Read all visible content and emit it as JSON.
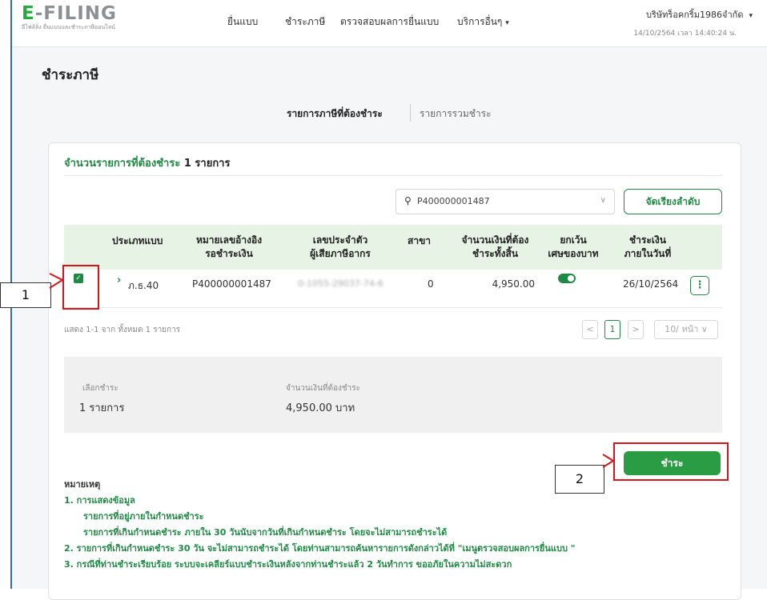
{
  "header": {
    "logo_main": "-FILING",
    "logo_e": "E",
    "logo_sub": "อีไฟล์ลิ่ง ยื่นแบบและชำระภาษีออนไลน์",
    "nav": [
      "ยื่นแบบ",
      "ชำระภาษี",
      "ตรวจสอบผลการยื่นแบบ",
      "บริการอื่นๆ"
    ],
    "nav_more_caret": "▾",
    "user_name": "บริษัทร็อคกริ้ม1986จำกัด",
    "user_caret": "▾",
    "date_text": "14/10/2564 เวลา 14:40:24 น."
  },
  "page": {
    "title": "ชำระภาษี",
    "tabs": [
      "รายการภาษีที่ต้องชำระ",
      "รายการรวมชำระ"
    ]
  },
  "card": {
    "count_label": "จำนวนรายการที่ต้องชำระ",
    "count_value": "1 รายการ",
    "search_value": "P400000001487",
    "sort_label": "จัดเรียงลำดับ"
  },
  "table": {
    "headers": {
      "type": "ประเภทแบบ",
      "ref_1": "หมายเลขอ้างอิง",
      "ref_2": "รอชำระเงิน",
      "taxid_1": "เลขประจำตัว",
      "taxid_2": "ผู้เสียภาษีอากร",
      "branch": "สาขา",
      "amount_1": "จำนวนเงินที่ต้อง",
      "amount_2": "ชำระทั้งสิ้น",
      "exempt_1": "ยกเว้น",
      "exempt_2": "เศษของบาท",
      "due_1": "ชำระเงิน",
      "due_2": "ภายในวันที่"
    },
    "rows": [
      {
        "type": "ภ.ธ.40",
        "ref": "P400000001487",
        "taxid": "0-1055-29037-74-6",
        "branch": "0",
        "amount": "4,950.00",
        "due": "26/10/2564"
      }
    ]
  },
  "pager": {
    "info": "แสดง 1-1 จาก ทั้งหมด 1 รายการ",
    "prev": "<",
    "current": "1",
    "next": ">",
    "per_page": "10/ หน้า ∨"
  },
  "summary": {
    "selected_label": "เลือกชำระ",
    "selected_value": "1 รายการ",
    "amount_label": "จำนวนเงินที่ต้องชำระ",
    "amount_value": "4,950.00 บาท"
  },
  "pay_button": "ชำระ",
  "notes": {
    "heading": "หมายเหตุ",
    "lines": [
      "1. การแสดงข้อมูล",
      "รายการที่อยู่ภายในกำหนดชำระ",
      "รายการที่เกินกำหนดชำระ ภายใน 30 วันนับจากวันที่เกินกำหนดชำระ โดยจะไม่สามารถชำระได้",
      "2. รายการที่เกินกำหนดชำระ 30 วัน จะไม่สามารถชำระได้ โดยท่านสามารถค้นหารายการดังกล่าวได้ที่ \"เมนูตรวจสอบผลการยื่นแบบ \"",
      "3. กรณีที่ท่านชำระเรียบร้อย ระบบจะเคลียร์แบบชำระเงินหลังจากท่านชำระแล้ว 2 วันทำการ ขออภัยในความไม่สะดวก"
    ]
  },
  "annotations": {
    "callout_1": "1",
    "callout_2": "2"
  },
  "icons": {
    "search": "search-icon",
    "checkbox": "checkbox-checked-icon",
    "expand": "chevron-right-icon",
    "toggle": "toggle-on-icon",
    "more": "kebab-menu-icon"
  },
  "colors": {
    "brand_green": "#1f8a43",
    "header_bg": "#e7f4e5",
    "annotation_red": "#d8141b",
    "frame_blue": "#2e6fb5"
  }
}
